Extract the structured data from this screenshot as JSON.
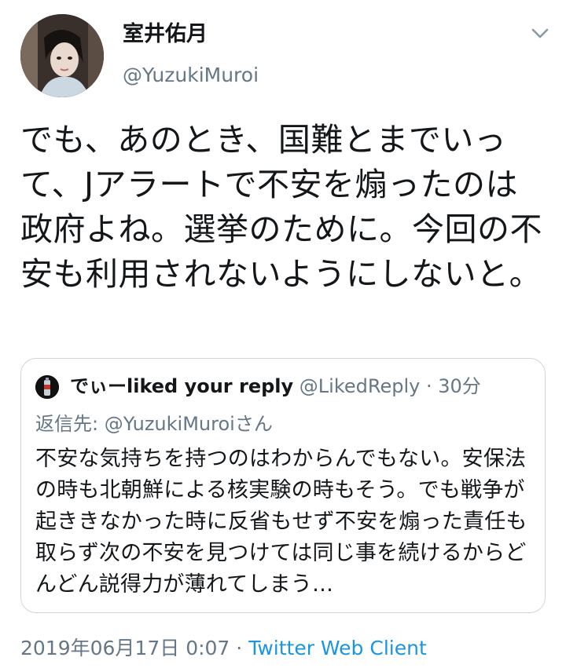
{
  "author": {
    "display_name": "室井佑月",
    "handle": "@YuzukiMuroi"
  },
  "icons": {
    "more": "chevron-down-icon",
    "avatar": "avatar",
    "quote_avatar": "avatar"
  },
  "tweet": {
    "text": "でも、あのとき、国難とまでいって、Jアラートで不安を煽ったのは政府よね。選挙のために。今回の不安も利用されないようにしないと。"
  },
  "quote": {
    "name": "でぃーliked your  reply",
    "handle": "@LikedReply",
    "separator": " · ",
    "time": "30分",
    "reply_to": "返信先: @YuzukiMuroiさん",
    "text": "不安な気持ちを持つのはわからんでもない。安保法の時も北朝鮮による核実験の時もそう。でも戦争が起ききなかった時に反省もせず不安を煽った責任も取らず次の不安を見つけては同じ事を続けるからどんどん説得力が薄れてしまう…"
  },
  "footer": {
    "timestamp": "2019年06月17日 0:07",
    "separator": " · ",
    "client": "Twitter Web Client"
  },
  "colors": {
    "text": "#14171a",
    "secondary": "#657786",
    "link": "#1b95e0",
    "border": "#ccd6dd"
  }
}
